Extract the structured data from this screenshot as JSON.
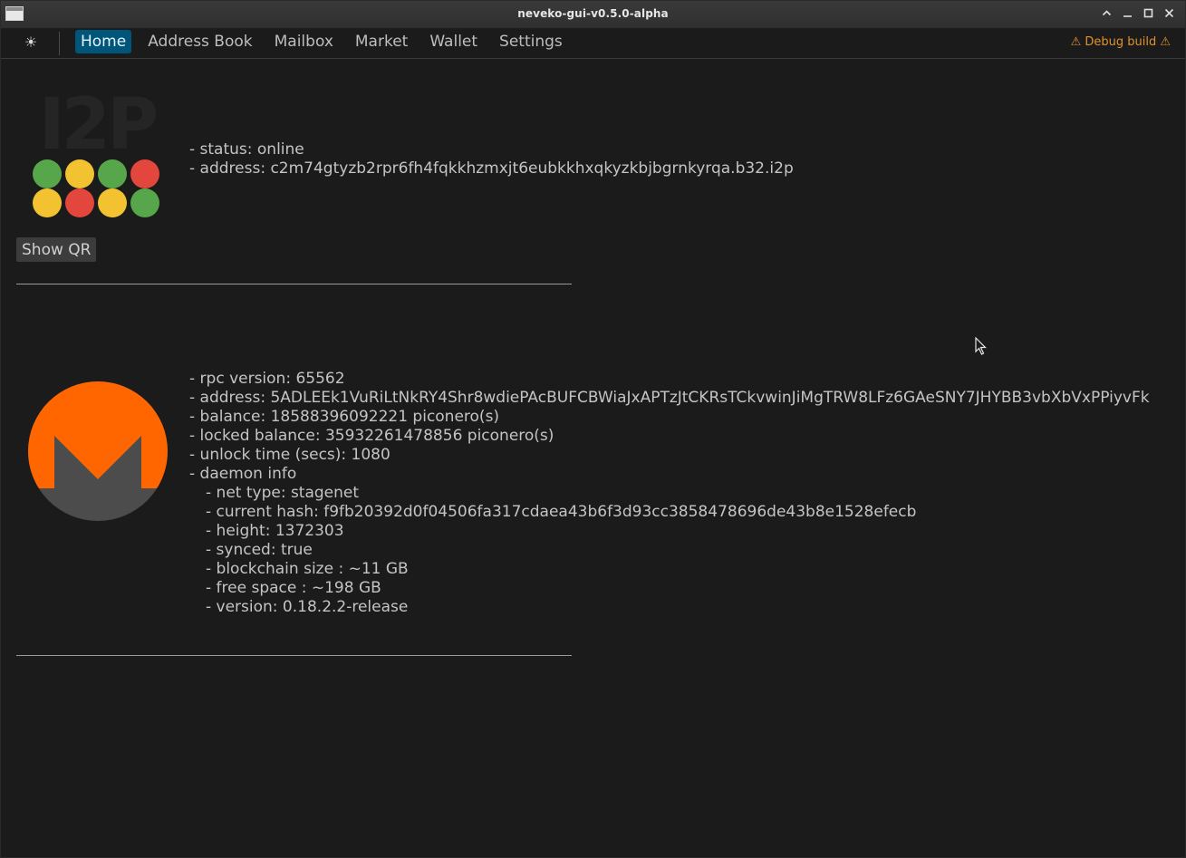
{
  "window": {
    "title": "neveko-gui-v0.5.0-alpha",
    "controls": {
      "collapse": "chevron-up-icon",
      "minimize": "minimize-icon",
      "maximize": "maximize-icon",
      "close": "close-icon"
    }
  },
  "navbar": {
    "theme_icon": "☀",
    "tabs": [
      {
        "label": "Home",
        "active": true
      },
      {
        "label": "Address Book",
        "active": false
      },
      {
        "label": "Mailbox",
        "active": false
      },
      {
        "label": "Market",
        "active": false
      },
      {
        "label": "Wallet",
        "active": false
      },
      {
        "label": "Settings",
        "active": false
      }
    ],
    "debug_build": "⚠ Debug build ⚠"
  },
  "i2p": {
    "logo_text": "I2P",
    "lines": [
      "- status: online",
      "- address: c2m74gtyzb2rpr6fh4fqkkhzmxjt6eubkkhxqkyzkbjbgrnkyrqa.b32.i2p"
    ],
    "qr_button": "Show QR"
  },
  "monero": {
    "lines": [
      "- rpc version: 65562",
      "- address: 5ADLEEk1VuRiLtNkRY4Shr8wdiePAcBUFCBWiaJxAPTzJtCKRsTCkvwinJiMgTRW8LFz6GAeSNY7JHYBB3vbXbVxPPiyvFk",
      "- balance: 18588396092221 piconero(s)",
      "- locked balance: 35932261478856 piconero(s)",
      "- unlock time (secs): 1080",
      "- daemon info"
    ],
    "daemon_lines": [
      "- net type: stagenet",
      "- current hash: f9fb20392d0f04506fa317cdaea43b6f3d93cc3858478696de43b8e1528efecb",
      "- height: 1372303",
      "- synced: true",
      "- blockchain size : ~11 GB",
      "- free space : ~198 GB",
      "- version: 0.18.2.2-release"
    ]
  },
  "colors": {
    "background": "#1b1b1b",
    "active_tab": "#00557a",
    "warning": "#e0922c",
    "monero_orange": "#ff6600",
    "monero_gray": "#4c4c4c",
    "dot_green": "#58a64b",
    "dot_yellow": "#f2c230",
    "dot_red": "#e3463c"
  }
}
